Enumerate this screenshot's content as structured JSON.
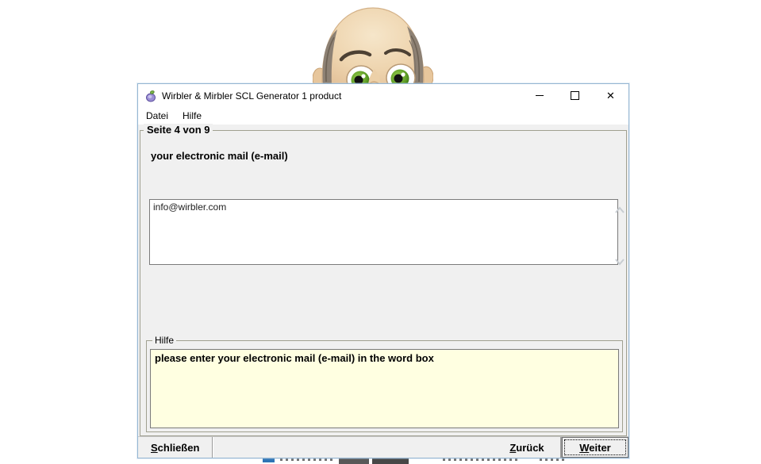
{
  "window": {
    "title": "Wirbler & Mirbler SCL Generator 1 product",
    "controls": {
      "close_glyph": "✕"
    }
  },
  "menu": {
    "items": [
      {
        "label": "Datei"
      },
      {
        "label": "Hilfe"
      }
    ]
  },
  "page": {
    "group_title": "Seite 4 von 9",
    "field_label": "your electronic mail (e-mail)",
    "email_value": "info@wirbler.com",
    "help_group_title": "Hilfe",
    "help_text": "please enter your electronic mail (e-mail) in the word box"
  },
  "buttons": {
    "close": {
      "accel": "S",
      "rest": "chließen"
    },
    "back": {
      "accel": "Z",
      "rest": "urück"
    },
    "next": {
      "accel": "W",
      "rest": "eiter"
    }
  },
  "colors": {
    "help_bg": "#ffffe1",
    "client_bg": "#f0f0f0",
    "titlebar_bg": "#ffffff",
    "window_border": "#96b6d2"
  }
}
